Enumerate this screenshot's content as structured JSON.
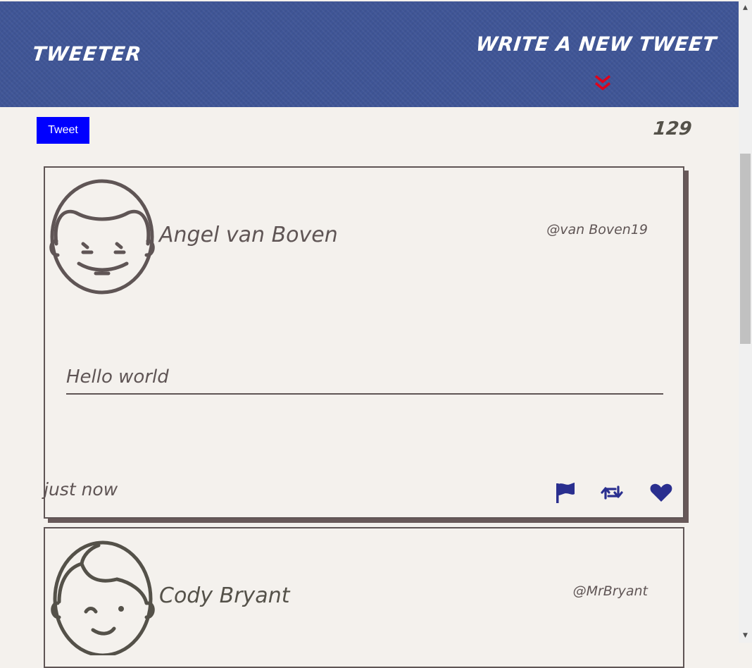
{
  "header": {
    "brand": "TWEETER",
    "compose_label": "WRITE A NEW TWEET"
  },
  "composer": {
    "tweet_button_label": "Tweet",
    "char_counter": "129"
  },
  "tweets": [
    {
      "display_name": "Angel van Boven",
      "handle": "@van Boven19",
      "content": "Hello world",
      "timestamp": "just now",
      "avatar_icon": "avatar-smiling-face-icon",
      "actions": [
        "flag-icon",
        "retweet-icon",
        "heart-icon"
      ]
    },
    {
      "display_name": "Cody Bryant",
      "handle": "@MrBryant",
      "avatar_icon": "avatar-winking-face-icon"
    }
  ],
  "colors": {
    "header_bg": "#3f5596",
    "page_bg": "#f4f1ed",
    "tweet_button_bg": "#0000ff",
    "chevron": "#e0001a",
    "action_icons": "#2a2f8f",
    "card_border": "#5f5555"
  }
}
